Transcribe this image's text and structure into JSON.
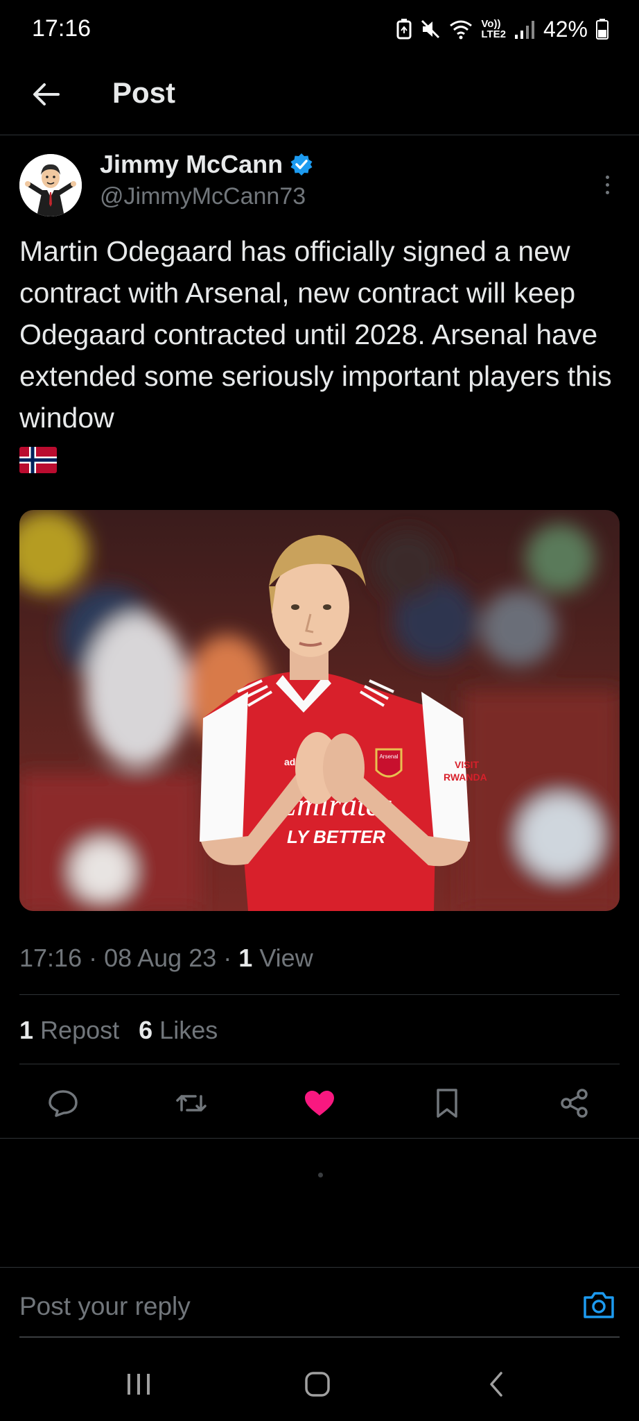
{
  "status_bar": {
    "time": "17:16",
    "network_label_top": "Vo))",
    "network_label_bottom": "LTE2",
    "battery": "42%"
  },
  "header": {
    "title": "Post"
  },
  "tweet": {
    "author_name": "Jimmy McCann",
    "author_handle": "@JimmyMcCann73",
    "text": "Martin Odegaard has officially signed a new contract with Arsenal, new contract will keep Odegaard contracted until 2028. Arsenal have extended some seriously important players this window",
    "time": "17:16",
    "date": "08 Aug 23",
    "views_count": "1",
    "views_label": "View",
    "reposts_count": "1",
    "reposts_label": "Repost",
    "likes_count": "6",
    "likes_label": "Likes",
    "image": {
      "sponsor_text": "Emirates",
      "sponsor_slogan": "LY BETTER",
      "badge_text": "Arsenal",
      "sleeve_text_top": "VISIT",
      "sleeve_text_bottom": "RWANDA"
    }
  },
  "reply": {
    "placeholder": "Post your reply"
  },
  "colors": {
    "accent_blue": "#1d9bf0",
    "like_pink": "#f91880",
    "muted": "#71767b",
    "background": "#000000"
  },
  "icons": [
    "back-arrow-icon",
    "verified-badge-icon",
    "more-icon",
    "reply-icon",
    "repost-icon",
    "like-icon",
    "bookmark-icon",
    "share-icon",
    "camera-icon",
    "recent-apps-icon",
    "home-icon",
    "nav-back-icon"
  ]
}
